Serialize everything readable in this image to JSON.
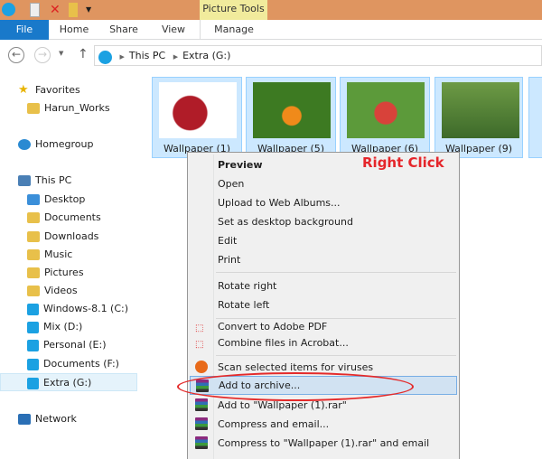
{
  "titlebar": {
    "contextual_tab": "Picture Tools"
  },
  "ribbon": {
    "tabs": [
      "File",
      "Home",
      "Share",
      "View",
      "Manage"
    ]
  },
  "address": {
    "path": [
      "This PC",
      "Extra (G:)"
    ]
  },
  "sidebar": {
    "items": [
      "Favorites",
      "Harun_Works",
      "Homegroup",
      "This PC",
      "Desktop",
      "Documents",
      "Downloads",
      "Music",
      "Pictures",
      "Videos",
      "Windows-8.1 (C:)",
      "Mix (D:)",
      "Personal (E:)",
      "Documents (F:)",
      "Extra (G:)",
      "Network"
    ],
    "selected": "Extra (G:)"
  },
  "files": [
    "Wallpaper (1)",
    "Wallpaper (5)",
    "Wallpaper (6)",
    "Wallpaper (9)"
  ],
  "menu": {
    "items": [
      "Preview",
      "Open",
      "Upload to Web Albums...",
      "Set as desktop background",
      "Edit",
      "Print",
      "Rotate right",
      "Rotate left",
      "Convert to Adobe PDF",
      "Combine files in Acrobat...",
      "Scan selected items for viruses",
      "Add to archive...",
      "Add to \"Wallpaper (1).rar\"",
      "Compress and email...",
      "Compress to \"Wallpaper (1).rar\" and email"
    ],
    "highlighted": "Add to archive..."
  },
  "annotation": "Right Click"
}
